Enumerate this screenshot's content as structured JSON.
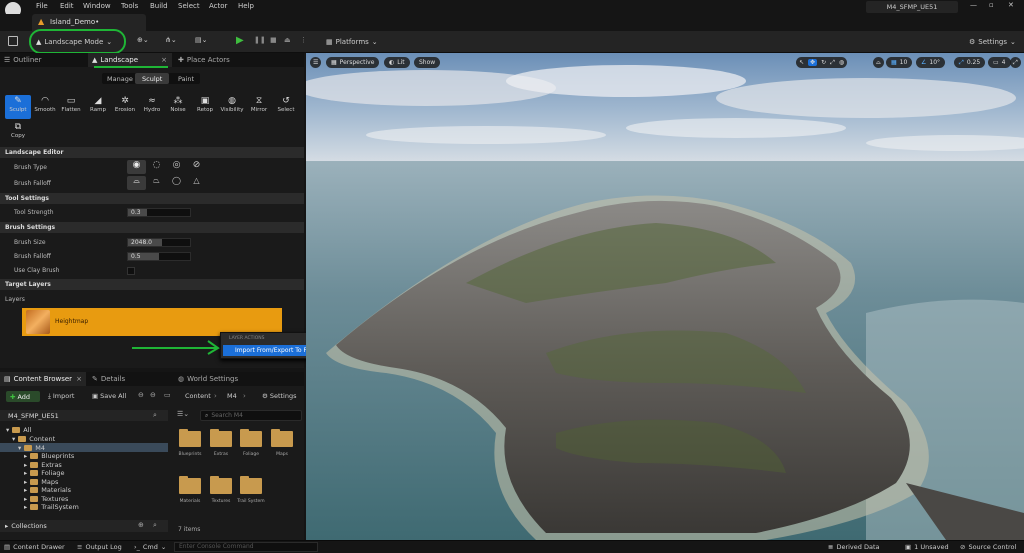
{
  "menu": [
    "File",
    "Edit",
    "Window",
    "Tools",
    "Build",
    "Select",
    "Actor",
    "Help"
  ],
  "project_badge": "M4_SFMP_UE51",
  "document_tab": "Island_Demo•",
  "toolbar": {
    "mode": "Landscape Mode",
    "platforms": "Platforms",
    "settings": "Settings"
  },
  "panel_tabs": {
    "outliner": "Outliner",
    "landscape": "Landscape",
    "place_actors": "Place Actors"
  },
  "mode_tabs": [
    "Manage",
    "Sculpt",
    "Paint"
  ],
  "tools": [
    "Sculpt",
    "Smooth",
    "Flatten",
    "Ramp",
    "Erosion",
    "Hydro",
    "Noise",
    "Retop",
    "Visibility",
    "Mirror",
    "Select",
    "Copy"
  ],
  "sections": {
    "editor": "Landscape Editor",
    "tool_settings": "Tool Settings",
    "brush_settings": "Brush Settings",
    "target_layers": "Target Layers",
    "layers": "Layers"
  },
  "props": {
    "brush_type": "Brush Type",
    "brush_falloff": "Brush Falloff",
    "tool_strength": "Tool Strength",
    "tool_strength_val": "0.3",
    "brush_size": "Brush Size",
    "brush_size_val": "2048.0",
    "brush_falloff2": "Brush Falloff",
    "brush_falloff_val": "0.5",
    "use_clay": "Use Clay Brush"
  },
  "layer_name": "Heightmap",
  "context_menu": {
    "header": "LAYER ACTIONS",
    "item": "Import From/Export To File..."
  },
  "bottom_tabs": {
    "content_browser": "Content Browser",
    "details": "Details",
    "world_settings": "World Settings"
  },
  "cb_toolbar": {
    "add": "Add",
    "import": "Import",
    "save_all": "Save All",
    "crumb1": "Content",
    "crumb2": "M4",
    "settings": "Settings"
  },
  "cb_project": "M4_SFMP_UE51",
  "search_placeholder": "Search M4",
  "tree": [
    "All",
    "Content",
    "M4",
    "Blueprints",
    "Extras",
    "Foliage",
    "Maps",
    "Materials",
    "Textures",
    "TrailSystem"
  ],
  "assets": [
    "Blueprints",
    "Extras",
    "Foliage",
    "Maps",
    "Materials",
    "Textures",
    "Trail System"
  ],
  "item_count": "7 items",
  "collections": "Collections",
  "viewport": {
    "perspective": "Perspective",
    "lit": "Lit",
    "show": "Show",
    "grid": "10",
    "angle": "10°",
    "scale": "0.25",
    "cams": "4"
  },
  "status": {
    "drawer": "Content Drawer",
    "output": "Output Log",
    "cmd": "Cmd",
    "console_placeholder": "Enter Console Command",
    "derived": "Derived Data",
    "unsaved": "1 Unsaved",
    "source": "Source Control"
  }
}
